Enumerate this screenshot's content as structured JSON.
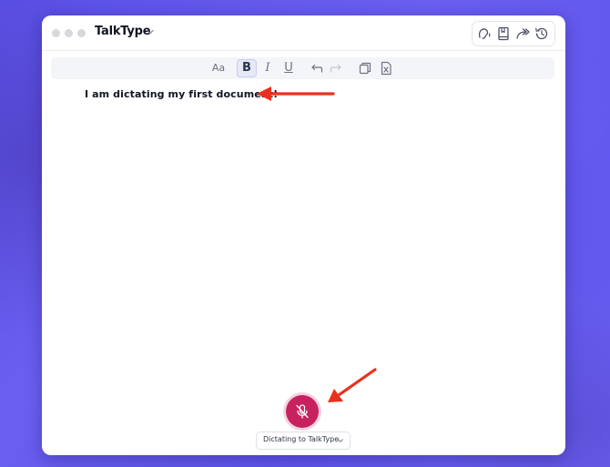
{
  "app": {
    "title": "TalkType"
  },
  "header_actions": [
    {
      "icon": "listen-icon"
    },
    {
      "icon": "book-icon"
    },
    {
      "icon": "share-icon"
    },
    {
      "icon": "history-icon"
    }
  ],
  "toolbar": {
    "font_label": "Aa",
    "bold_label": "B",
    "italic_label": "I",
    "underline_label": "U",
    "undo_icon": "undo-icon",
    "redo_icon": "redo-icon",
    "copy_icon": "copy-icon",
    "export_icon": "export-excel-icon",
    "active": "bold"
  },
  "document": {
    "text": "I am dictating my first document!"
  },
  "dictation": {
    "mic_icon": "microphone-muted-icon",
    "target_label": "Dictating to TalkType"
  },
  "colors": {
    "background": "#5d54ea",
    "mic_button": "#c8215f",
    "annotation_arrow": "#e8321e",
    "text": "#111522"
  }
}
